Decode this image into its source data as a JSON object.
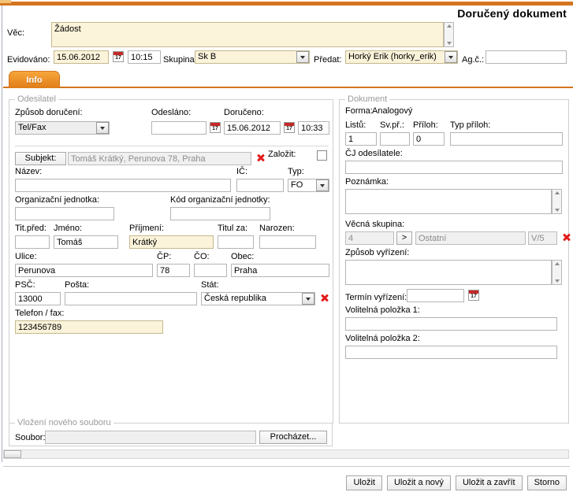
{
  "header": {
    "title": "Doručený dokument"
  },
  "top_form": {
    "subject_label": "Věc:",
    "subject_value": "Žádost",
    "registered_label": "Evidováno:",
    "registered_date": "15.06.2012",
    "registered_time": "10:15",
    "group_label": "Skupina:",
    "group_value": "Sk B",
    "handover_label": "Předat:",
    "handover_value": "Horký Erik (horky_erik)",
    "agenda_label": "Ag.č.:",
    "agenda_value": "",
    "calendar_day": "17"
  },
  "tabs": [
    {
      "label": "Info",
      "active": true
    }
  ],
  "sender": {
    "legend": "Odesilatel",
    "delivery_method_label": "Způsob doručení:",
    "delivery_method_value": "Tel/Fax",
    "sent_label": "Odesláno:",
    "sent_value": "",
    "delivered_label": "Doručeno:",
    "delivered_date": "15.06.2012",
    "delivered_time": "10:33",
    "subject_button": "Subjekt:",
    "subject_value": "Tomáš Krátký, Perunova 78, Praha",
    "create_label": "Založit:",
    "name_label": "Název:",
    "name_value": "",
    "ico_label": "IČ:",
    "ico_value": "",
    "type_label": "Typ:",
    "type_value": "FO",
    "org_unit_label": "Organizační jednotka:",
    "org_unit_value": "",
    "org_unit_code_label": "Kód organizační jednotky:",
    "org_unit_code_value": "",
    "title_before_label": "Tit.před:",
    "title_before_value": "",
    "firstname_label": "Jméno:",
    "firstname_value": "Tomáš",
    "surname_label": "Příjmení:",
    "surname_value": "Krátký",
    "title_after_label": "Titul za:",
    "title_after_value": "",
    "born_label": "Narozen:",
    "born_value": "",
    "street_label": "Ulice:",
    "street_value": "Perunova",
    "cp_label": "ČP:",
    "cp_value": "78",
    "co_label": "ČO:",
    "co_value": "",
    "city_label": "Obec:",
    "city_value": "Praha",
    "zip_label": "PSČ:",
    "zip_value": "13000",
    "post_label": "Pošta:",
    "post_value": "",
    "state_label": "Stát:",
    "state_value": "Česká republika",
    "phone_label": "Telefon / fax:",
    "phone_value": "123456789"
  },
  "document": {
    "legend": "Dokument",
    "form_label": "Forma:",
    "form_value": "Analogový",
    "sheets_label": "Listů:",
    "sheets_value": "1",
    "bundles_label": "Sv.př.:",
    "bundles_value": "",
    "attachments_label": "Příloh:",
    "attachments_value": "0",
    "attachment_type_label": "Typ příloh:",
    "attachment_type_value": "",
    "sender_ref_label": "ČJ odesílatele:",
    "sender_ref_value": "",
    "note_label": "Poznámka:",
    "note_value": "",
    "subject_group_label": "Věcná skupina:",
    "subject_group_code": "4",
    "subject_group_browse": ">",
    "subject_group_name": "Ostatní",
    "subject_group_sign": "V/5",
    "resolution_label": "Způsob vyřízení:",
    "resolution_value": "",
    "deadline_label": "Termín vyřízení:",
    "deadline_value": "",
    "optional1_label": "Volitelná položka 1:",
    "optional1_value": "",
    "optional2_label": "Volitelná položka 2:",
    "optional2_value": "",
    "calendar_day": "17"
  },
  "file_upload": {
    "legend": "Vložení nového souboru",
    "file_label": "Soubor:",
    "file_value": "",
    "browse_button": "Procházet..."
  },
  "footer_buttons": [
    {
      "label": "Uložit"
    },
    {
      "label": "Uložit a nový"
    },
    {
      "label": "Uložit a zavřít"
    },
    {
      "label": "Storno"
    }
  ],
  "colors": {
    "accent_orange": "#d4751e",
    "field_yellow": "#fbf3da",
    "icon_red": "#e21b1b"
  }
}
